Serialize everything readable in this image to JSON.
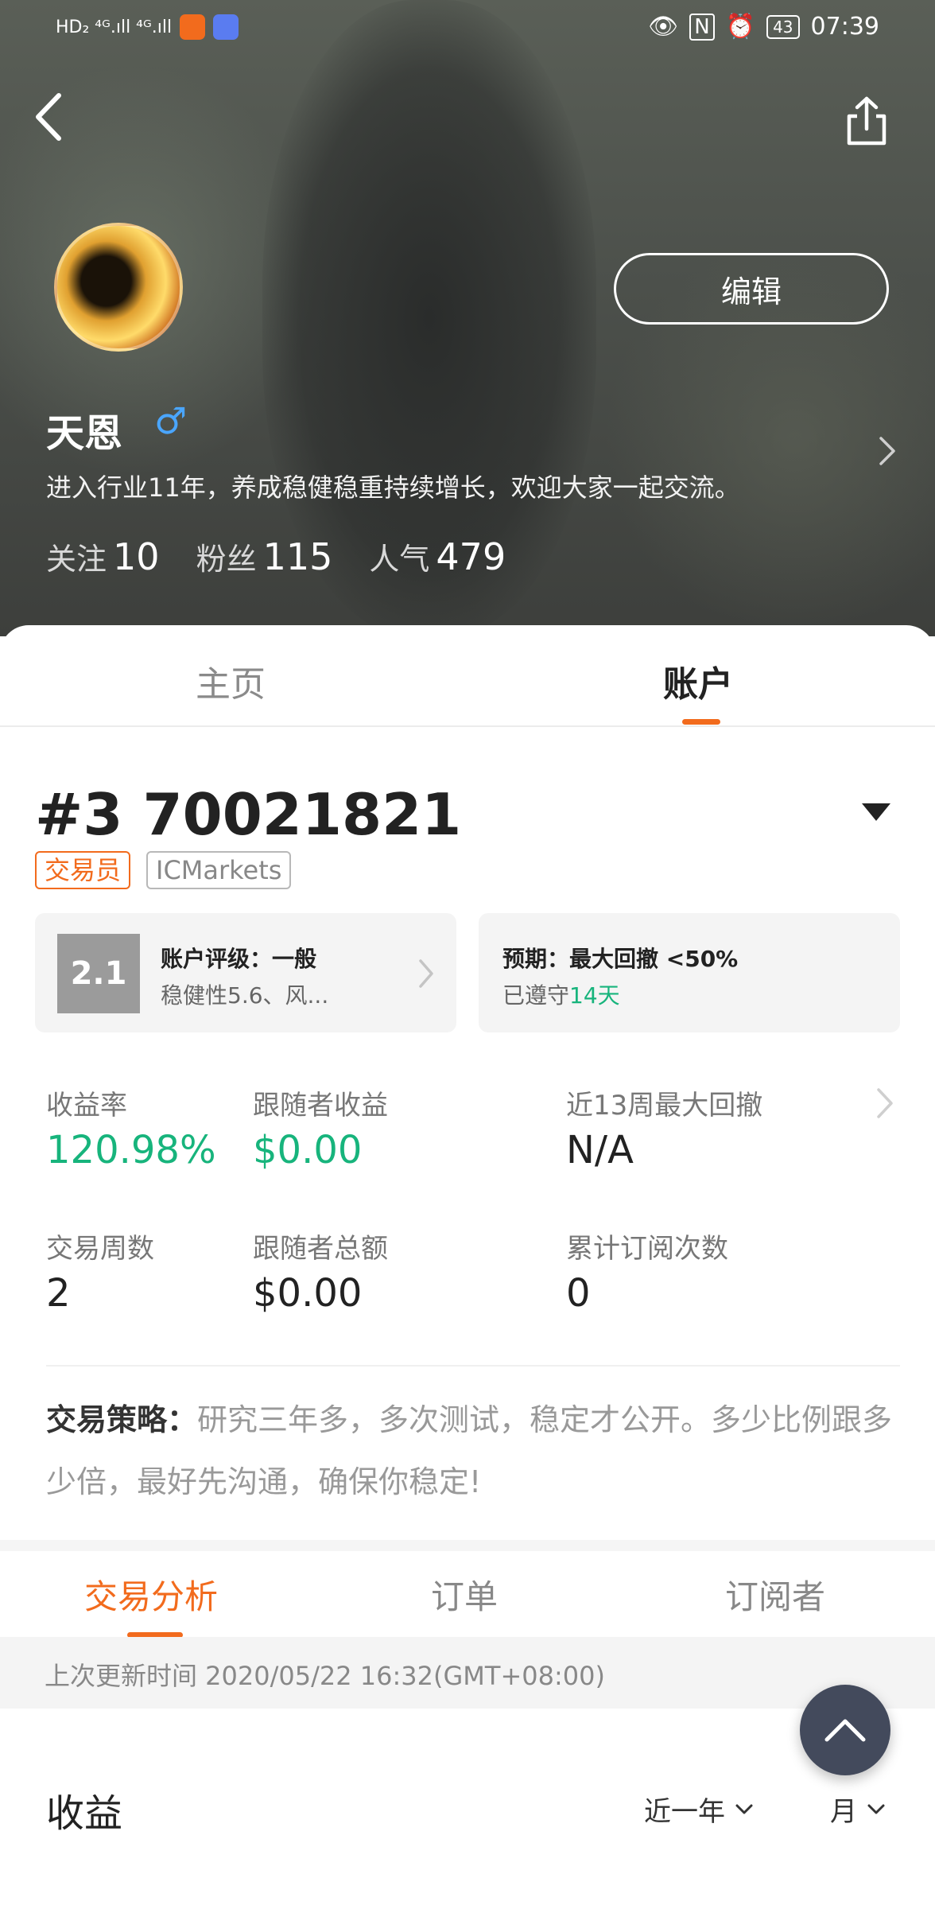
{
  "status_bar": {
    "network_left": "HD₂ ⁴ᴳ.ıll ⁴ᴳ.ıll",
    "time": "07:39",
    "battery": "43",
    "app_icon_colors": [
      "#f26b1d",
      "#5a7cf0"
    ]
  },
  "profile": {
    "edit_label": "编辑",
    "name": "天恩",
    "gender_symbol": "♂",
    "bio": "进入行业11年，养成稳健稳重持续增长，欢迎大家一起交流。",
    "stats": [
      {
        "label": "关注",
        "value": "10"
      },
      {
        "label": "粉丝",
        "value": "115"
      },
      {
        "label": "人气",
        "value": "479"
      }
    ]
  },
  "main_tabs": {
    "home": "主页",
    "account": "账户"
  },
  "account": {
    "number": "#3 70021821",
    "tag_role": "交易员",
    "tag_broker": "ICMarkets",
    "score": "2.1",
    "rating_title": "账户评级：一般",
    "rating_sub": "稳健性5.6、风...",
    "expect_title": "预期：最大回撤 <50%",
    "expect_sub_prefix": "已遵守",
    "expect_sub_days": "14天"
  },
  "metrics": {
    "return_label": "收益率",
    "return_value": "120.98%",
    "follower_income_label": "跟随者收益",
    "follower_income_value": "$0.00",
    "max_drawdown_label": "近13周最大回撤",
    "max_drawdown_value": "N/A",
    "weeks_label": "交易周数",
    "weeks_value": "2",
    "follower_total_label": "跟随者总额",
    "follower_total_value": "$0.00",
    "subs_count_label": "累计订阅次数",
    "subs_count_value": "0"
  },
  "strategy": {
    "label": "交易策略：",
    "text": "研究三年多，多次测试，稳定才公开。多少比例跟多少倍，最好先沟通，确保你稳定!"
  },
  "sub_tabs": {
    "analysis": "交易分析",
    "orders": "订单",
    "subscribers": "订阅者"
  },
  "update": {
    "text": "上次更新时间 2020/05/22 16:32(GMT+08:00)"
  },
  "income": {
    "title": "收益",
    "range": "近一年",
    "period": "月"
  },
  "colors": {
    "accent": "#f26b1d",
    "positive": "#17b47c",
    "fab": "#434a5c"
  }
}
